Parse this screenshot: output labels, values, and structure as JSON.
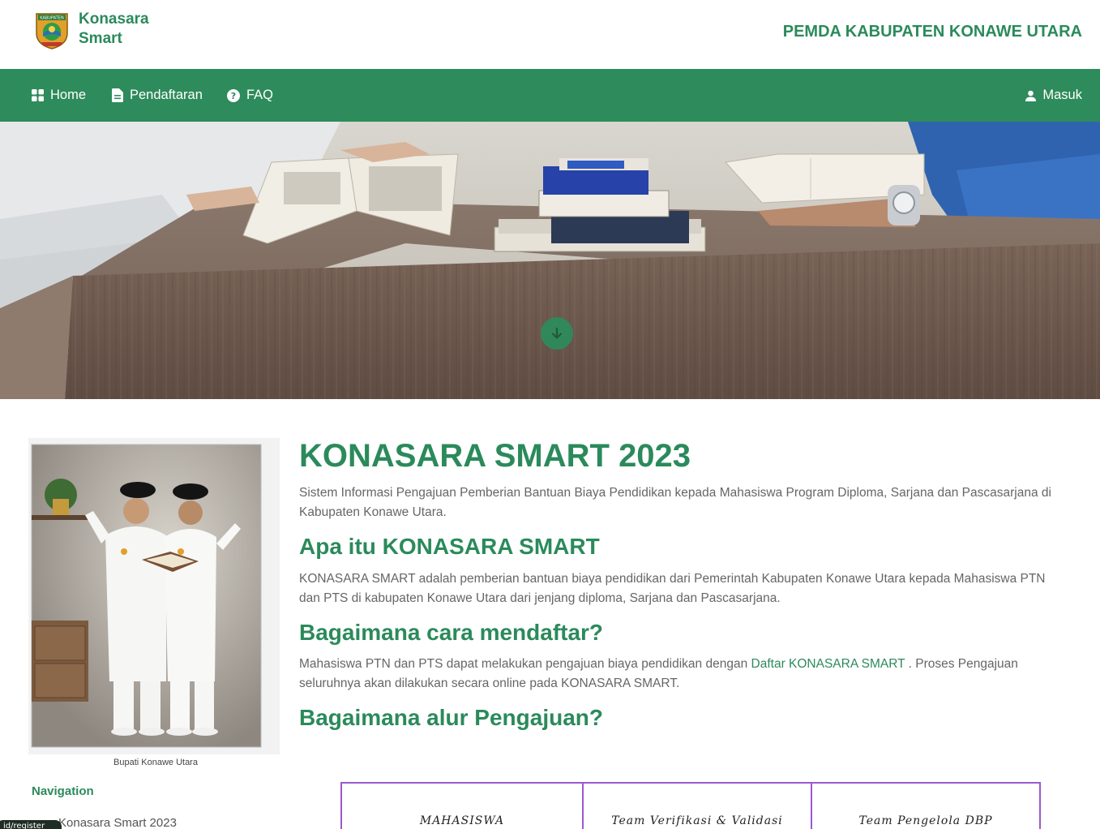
{
  "header": {
    "brand_line1": "Konasara",
    "brand_line2": "Smart",
    "logo_text": "KABUPATEN",
    "org_name": "PEMDA KABUPATEN KONAWE UTARA"
  },
  "nav": {
    "home": "Home",
    "pendaftaran": "Pendaftaran",
    "faq": "FAQ",
    "masuk": "Masuk"
  },
  "sidebar": {
    "caption": "Bupati Konawe Utara",
    "nav_heading": "Navigation",
    "nav_link": "Konasara Smart 2023",
    "badge_text": "id/register"
  },
  "main": {
    "title": "KONASARA SMART 2023",
    "intro_line1": "Sistem Informasi Pengajuan Pemberian Bantuan Biaya Pendidikan kepada Mahasiswa Program Diploma, Sarjana dan Pascasarjana di",
    "intro_line2": "Kabupaten Konawe Utara.",
    "h_what": "Apa itu KONASARA SMART",
    "what_line1": "KONASARA SMART adalah pemberian bantuan biaya pendidikan dari Pemerintah Kabupaten Konawe Utara kepada Mahasiswa PTN",
    "what_line2": "dan PTS di kabupaten Konawe Utara dari jenjang diploma, Sarjana dan Pascasarjana.",
    "h_how": "Bagaimana cara mendaftar?",
    "how_pre": "Mahasiswa PTN dan PTS dapat melakukan pengajuan biaya pendidikan dengan ",
    "how_link": "Daftar KONASARA SMART",
    "how_post": " . Proses Pengajuan",
    "how_line2": "seluruhnya akan dilakukan secara online pada KONASARA SMART.",
    "h_flow": "Bagaimana alur Pengajuan?"
  },
  "flow": {
    "step1": "MAHASISWA",
    "step2": "Team Verifikasi & Validasi",
    "step3": "Team Pengelola DBP"
  },
  "colors": {
    "brand_green": "#2e8b5b",
    "flow_border": "#9b59d0"
  }
}
